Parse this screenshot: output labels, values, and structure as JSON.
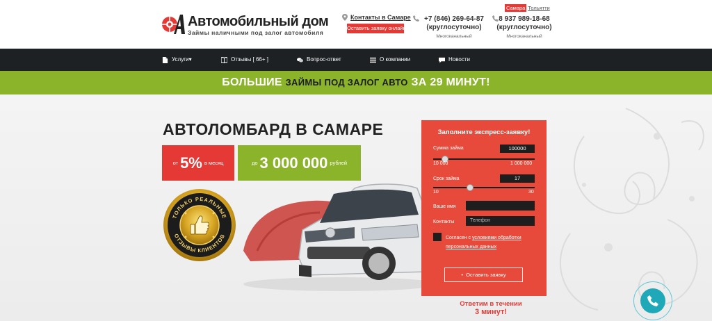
{
  "header": {
    "logo_title": "Автомобильный дом",
    "logo_subtitle": "Займы наличными под залог автомобиля",
    "contacts_link": "Контакты в Самаре",
    "request_button": "Оставить заявку онлайн",
    "phones": [
      {
        "number": "+7 (846) 269-64-87",
        "hours": "(круглосуточно)",
        "type": "Многоканальный"
      },
      {
        "number": "8 937 989-18-68",
        "hours": "(круглосуточно)",
        "type": "Многоканальный"
      }
    ],
    "cities": {
      "active": "Самара",
      "other": "Тольятти"
    }
  },
  "nav": {
    "items": [
      {
        "label": "Услуги▾",
        "icon": "document-icon"
      },
      {
        "label": "Отзывы [ 66+ ]",
        "icon": "book-icon"
      },
      {
        "label": "Вопрос-ответ",
        "icon": "chat-icon"
      },
      {
        "label": "О компании",
        "icon": "list-icon"
      },
      {
        "label": "Новости",
        "icon": "comment-icon"
      }
    ]
  },
  "banner": {
    "w1": "БОЛЬШИЕ",
    "d1": "ЗАЙМЫ ПОД ЗАЛОГ АВТО",
    "w2": "ЗА 29 МИНУТ!"
  },
  "hero": {
    "title": "АВТОЛОМБАРД В САМАРЕ",
    "rate_prefix": "от",
    "rate_value": "5%",
    "rate_suffix": "в месяц",
    "amount_prefix": "до",
    "amount_value": "3 000 000",
    "amount_suffix": "рублей",
    "seal_top": "ТОЛЬКО РЕАЛЬНЫЕ",
    "seal_bottom": "ОТЗЫВЫ КЛИЕНТОВ"
  },
  "form": {
    "title": "Заполните экспресс-заявку!",
    "sum_label": "Сумма займа",
    "sum_value": "100000",
    "sum_level": 0.09,
    "sum_min": "10 000",
    "sum_max": "1 000 000",
    "term_label": "Срок займа",
    "term_value": "17",
    "term_level": 0.35,
    "term_min": "10",
    "term_max": "30",
    "name_label": "Ваше имя",
    "name_value": "",
    "contacts_label": "Контакты",
    "phone_placeholder": "Телефон",
    "consent_text": "Согласен с",
    "consent_link": "условиями обработки персональных данных",
    "submit_label": "Оставить заявку"
  },
  "answer": {
    "line1": "Ответим в течении",
    "line2": "3 минут!"
  },
  "colors": {
    "accent_red": "#e53935",
    "accent_green": "#8bb42b",
    "nav_bg": "#1e2124",
    "call_teal": "#1fa8b8"
  }
}
